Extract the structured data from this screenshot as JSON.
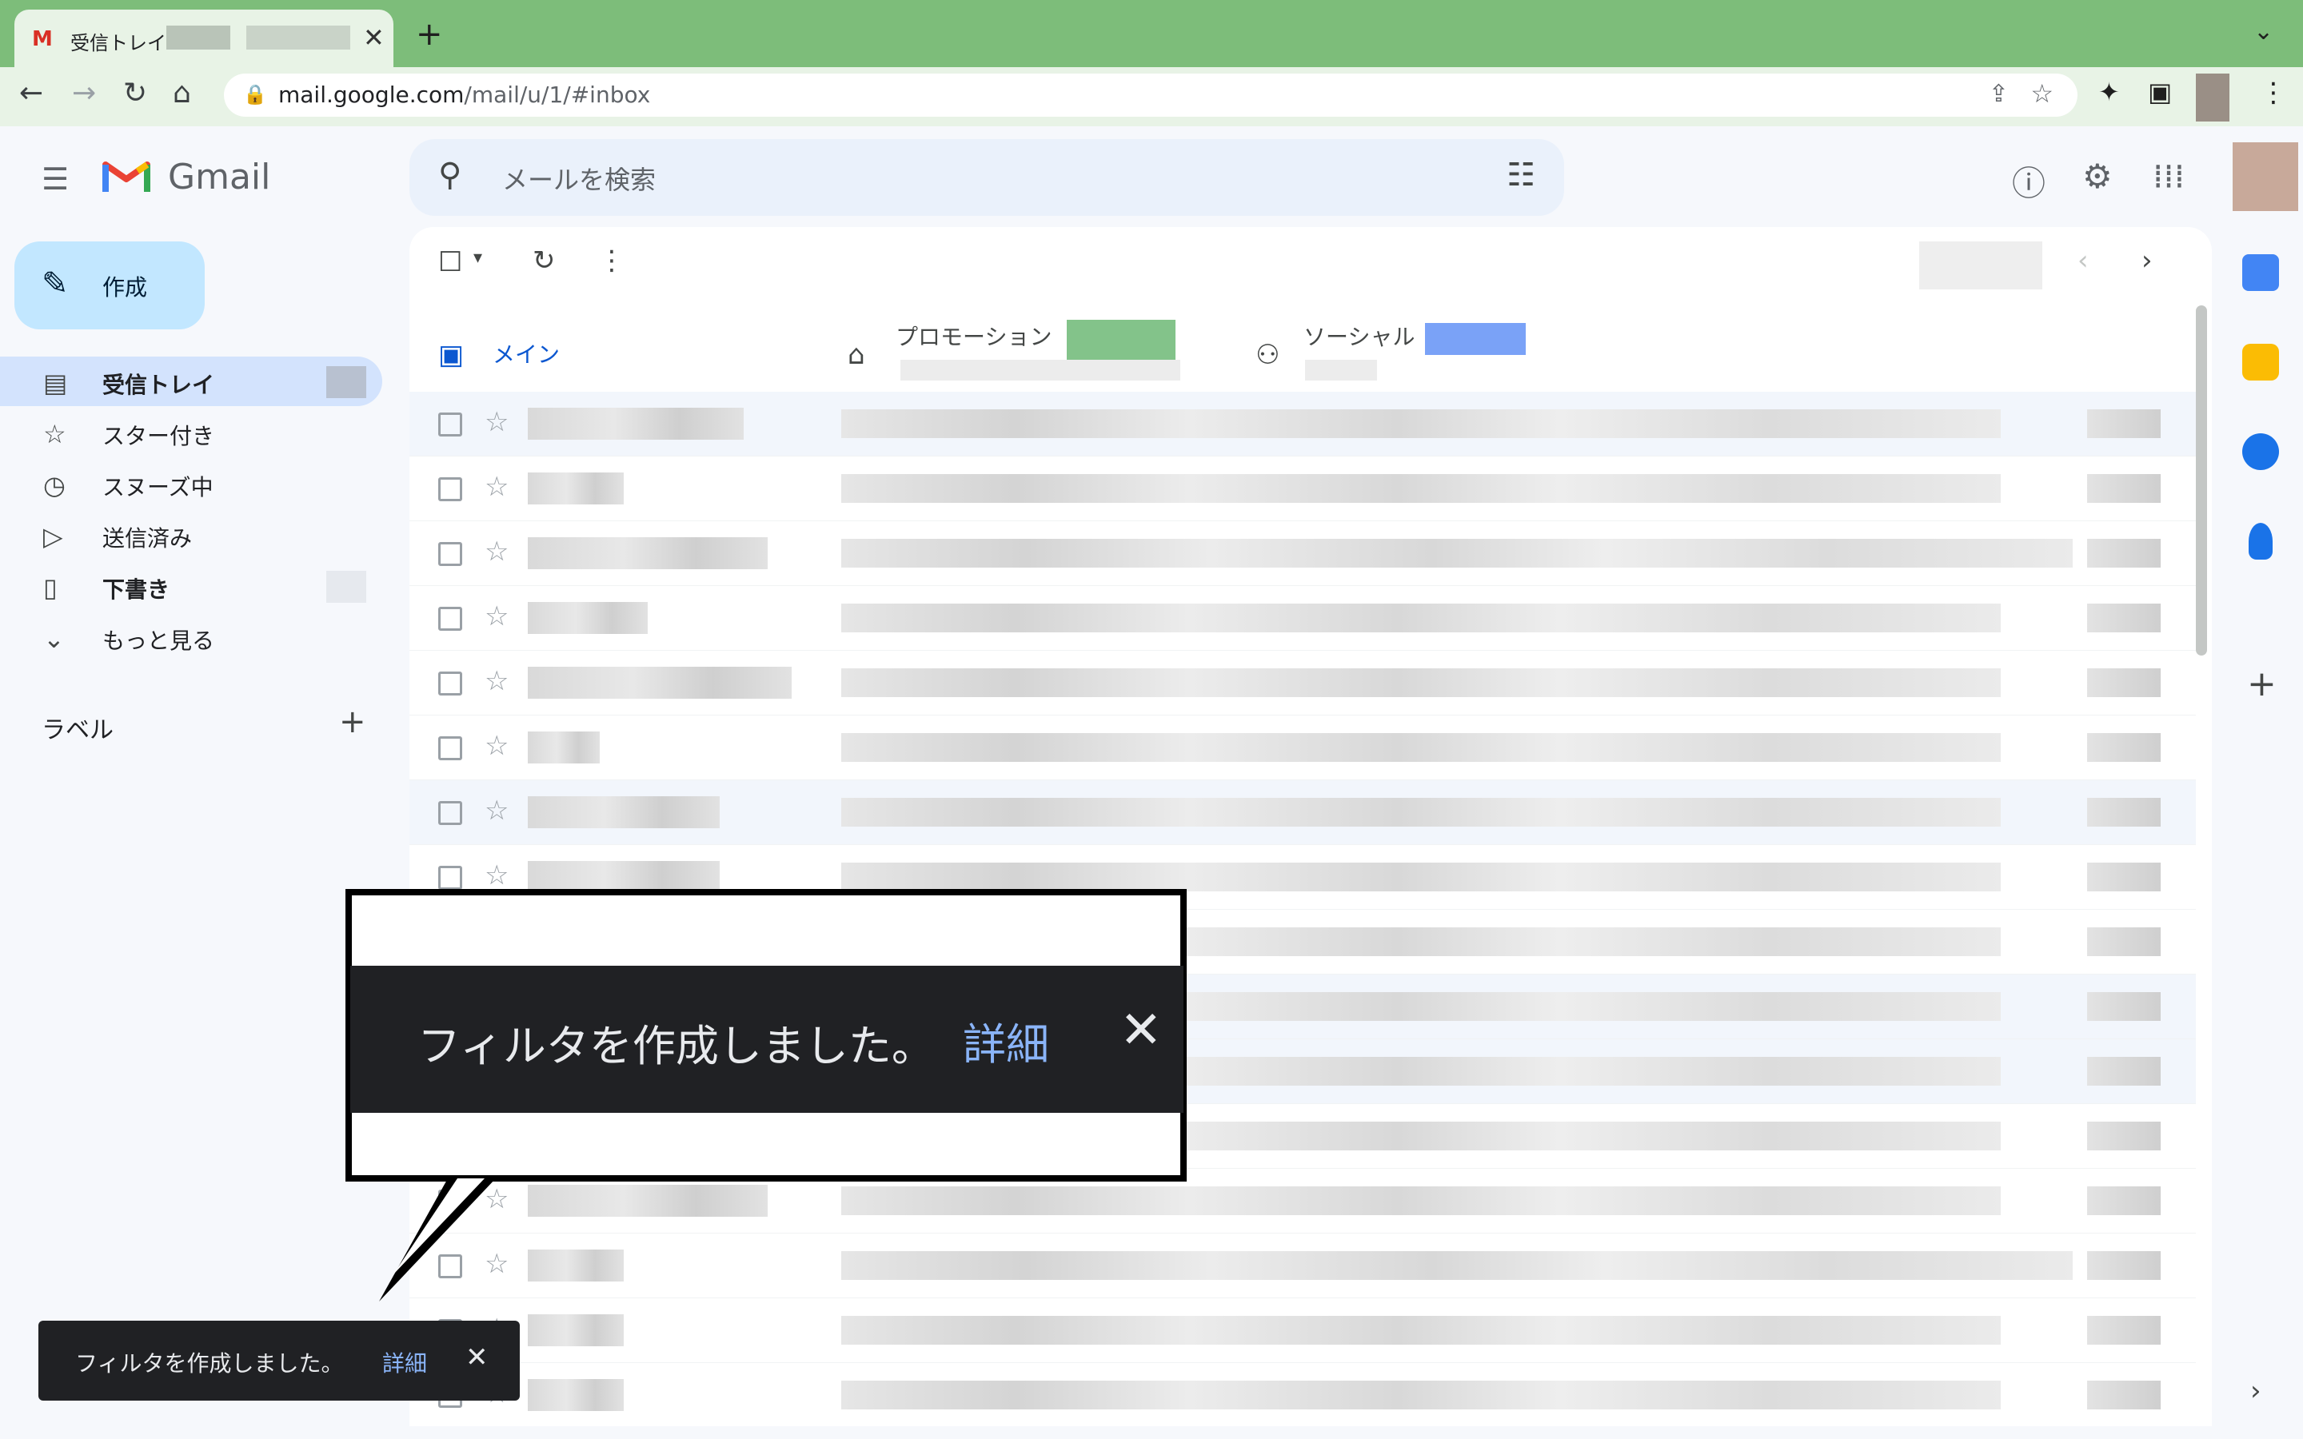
{
  "browser": {
    "tab_title": "受信トレイ",
    "tab_favicon": "M",
    "new_tab": "+",
    "url_domain": "mail.google.com",
    "url_path": "/mail/u/1/#inbox"
  },
  "gmail": {
    "app_name": "Gmail",
    "search_placeholder": "メールを検索",
    "compose_label": "作成",
    "nav": [
      {
        "label": "受信トレイ",
        "icon": "inbox-icon"
      },
      {
        "label": "スター付き",
        "icon": "star-icon"
      },
      {
        "label": "スヌーズ中",
        "icon": "clock-icon"
      },
      {
        "label": "送信済み",
        "icon": "send-icon"
      },
      {
        "label": "下書き",
        "icon": "file-icon"
      },
      {
        "label": "もっと見る",
        "icon": "chevron-down-icon"
      }
    ],
    "labels_heading": "ラベル",
    "category_tabs": [
      {
        "label": "メイン"
      },
      {
        "label": "プロモーション"
      },
      {
        "label": "ソーシャル"
      }
    ]
  },
  "callout_toast": {
    "message": "フィルタを作成しました。",
    "detail": "詳細"
  },
  "toast": {
    "message": "フィルタを作成しました。",
    "detail": "詳細"
  },
  "colors": {
    "tabstrip": "#7dbd7a",
    "accent_blue": "#0b57d0",
    "compose_bg": "#c2e7ff",
    "toast_bg": "#202124",
    "toast_link": "#8ab4f8"
  }
}
